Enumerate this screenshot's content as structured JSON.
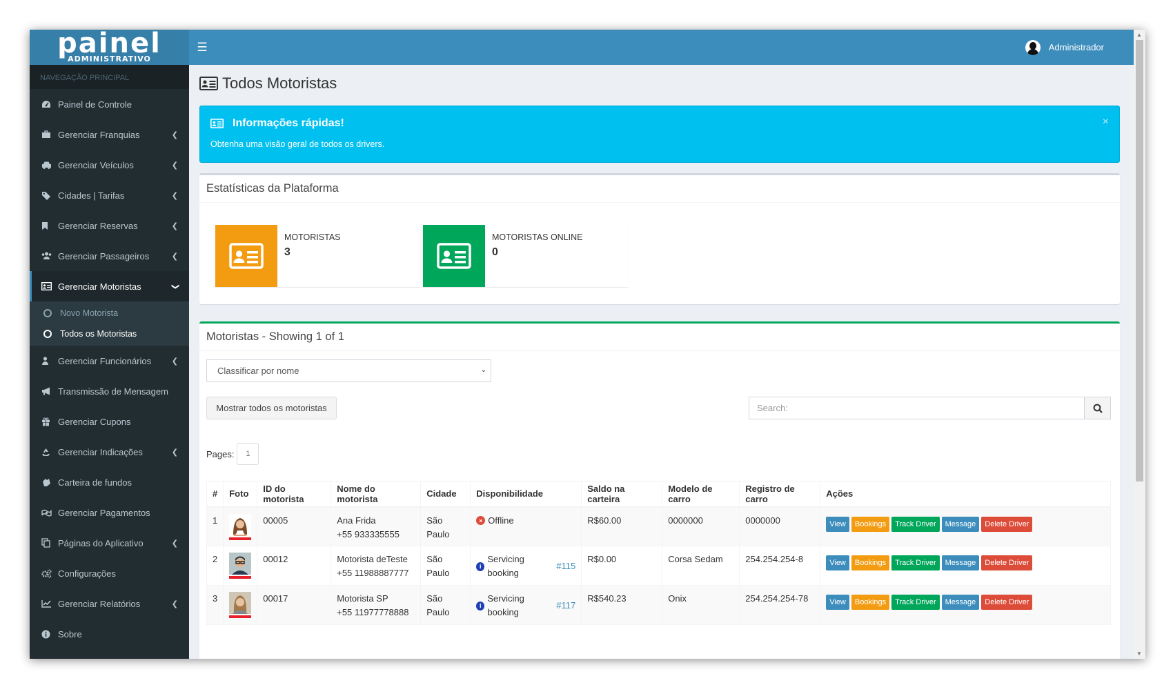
{
  "brand": {
    "logo_main": "painel",
    "logo_sub": "ADMINISTRATIVO"
  },
  "sidebar": {
    "header": "NAVEGAÇÃO PRINCIPAL",
    "items": [
      {
        "label": "Painel de Controle",
        "icon": "dashboard-icon"
      },
      {
        "label": "Gerenciar Franquias",
        "icon": "briefcase-icon"
      },
      {
        "label": "Gerenciar Veículos",
        "icon": "car-icon"
      },
      {
        "label": "Cidades | Tarifas",
        "icon": "tags-icon"
      },
      {
        "label": "Gerenciar Reservas",
        "icon": "bookmark-icon"
      },
      {
        "label": "Gerenciar Passageiros",
        "icon": "users-icon"
      },
      {
        "label": "Gerenciar Motoristas",
        "icon": "id-card-icon"
      },
      {
        "label": "Gerenciar Funcionários",
        "icon": "user-icon"
      },
      {
        "label": "Transmissão de Mensagem",
        "icon": "bullhorn-icon"
      },
      {
        "label": "Gerenciar Cupons",
        "icon": "gift-icon"
      },
      {
        "label": "Gerenciar Indicações",
        "icon": "recycle-icon"
      },
      {
        "label": "Carteira de fundos",
        "icon": "wallet-icon"
      },
      {
        "label": "Gerenciar Pagamentos",
        "icon": "money-icon"
      },
      {
        "label": "Páginas do Aplicativo",
        "icon": "copy-icon"
      },
      {
        "label": "Configurações",
        "icon": "cogs-icon"
      },
      {
        "label": "Gerenciar Relatórios",
        "icon": "line-chart-icon"
      },
      {
        "label": "Sobre",
        "icon": "info-icon"
      }
    ],
    "submenu": [
      {
        "label": "Novo Motorista"
      },
      {
        "label": "Todos os Motoristas"
      }
    ]
  },
  "topbar": {
    "user_name": "Administrador"
  },
  "page": {
    "title": "Todos Motoristas"
  },
  "alert": {
    "title": "Informações rápidas!",
    "message": "Obtenha uma visão geral de todos os drivers.",
    "close": "×"
  },
  "stats": {
    "title": "Estatísticas da Plataforma",
    "boxes": [
      {
        "label": "MOTORISTAS",
        "value": "3",
        "color": "#f39c12"
      },
      {
        "label": "MOTORISTAS ONLINE",
        "value": "0",
        "color": "#00a65a"
      }
    ]
  },
  "drivers": {
    "title": "Motoristas - Showing 1 of 1",
    "sort_select": "Classificar por nome",
    "show_all_button": "Mostrar todos os motoristas",
    "search_placeholder": "Search:",
    "pages_label": "Pages:",
    "page_number": "1",
    "columns": [
      "#",
      "Foto",
      "ID do motorista",
      "Nome do motorista",
      "Cidade",
      "Disponibilidade",
      "Saldo na carteira",
      "Modelo de carro",
      "Registro de carro",
      "Ações"
    ],
    "rows": [
      {
        "num": "1",
        "id": "00005",
        "name": "Ana Frida",
        "phone": "+55 933335555",
        "city": "São Paulo",
        "status": "Offline",
        "booking": "",
        "balance": "R$60.00",
        "model": "0000000",
        "plate": "0000000"
      },
      {
        "num": "2",
        "id": "00012",
        "name": "Motorista deTeste",
        "phone": "+55 11988887777",
        "city": "São Paulo",
        "status": "Servicing booking",
        "booking": "#115",
        "balance": "R$0.00",
        "model": "Corsa Sedam",
        "plate": "254.254.254-8"
      },
      {
        "num": "3",
        "id": "00017",
        "name": "Motorista SP",
        "phone": "+55 11977778888",
        "city": "São Paulo",
        "status": "Servicing booking",
        "booking": "#117",
        "balance": "R$540.23",
        "model": "Onix",
        "plate": "254.254.254-78"
      }
    ],
    "actions": {
      "view": "View",
      "bookings": "Bookings",
      "track": "Track Driver",
      "message": "Message",
      "delete": "Delete Driver"
    }
  }
}
